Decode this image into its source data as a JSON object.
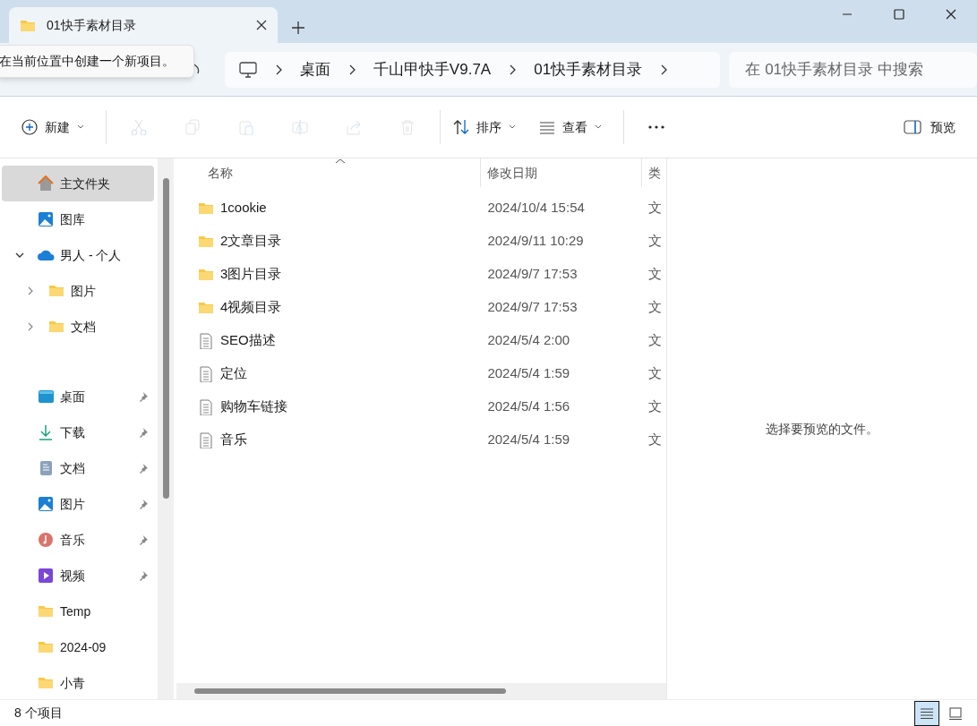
{
  "tab": {
    "title": "01快手素材目录",
    "selected": true
  },
  "tooltip": "在当前位置中创建一个新项目。",
  "breadcrumb": [
    "桌面",
    "千山甲快手V9.7A",
    "01快手素材目录"
  ],
  "search": {
    "placeholder": "在 01快手素材目录 中搜索"
  },
  "toolbar": [
    {
      "kind": "new",
      "label": "新建",
      "disabled": false
    },
    {
      "kind": "cut",
      "disabled": true
    },
    {
      "kind": "copy",
      "disabled": true
    },
    {
      "kind": "paste",
      "disabled": true
    },
    {
      "kind": "rename",
      "disabled": true
    },
    {
      "kind": "share",
      "disabled": true
    },
    {
      "kind": "delete",
      "disabled": true
    },
    {
      "kind": "sort",
      "label": "排序",
      "disabled": false
    },
    {
      "kind": "view",
      "label": "查看",
      "disabled": false
    },
    {
      "kind": "more",
      "disabled": false
    }
  ],
  "preview_button": "预览",
  "sidebar": [
    {
      "kind": "home",
      "label": "主文件夹",
      "selected": true
    },
    {
      "kind": "gallery",
      "label": "图库",
      "selected": false
    },
    {
      "kind": "cloud",
      "label": "男人 - 个人",
      "selected": false,
      "expanded": true,
      "children": [
        {
          "kind": "folder",
          "label": "图片",
          "selected": false,
          "expanded": false
        },
        {
          "kind": "folder",
          "label": "文档",
          "selected": false,
          "expanded": false
        }
      ]
    },
    {
      "kind": "divider"
    },
    {
      "kind": "desktop",
      "label": "桌面",
      "selected": false,
      "pinned": true
    },
    {
      "kind": "download",
      "label": "下载",
      "selected": false,
      "pinned": true
    },
    {
      "kind": "documents",
      "label": "文档",
      "selected": false,
      "pinned": true
    },
    {
      "kind": "pictures",
      "label": "图片",
      "selected": false,
      "pinned": true
    },
    {
      "kind": "music",
      "label": "音乐",
      "selected": false,
      "pinned": true
    },
    {
      "kind": "video",
      "label": "视频",
      "selected": false,
      "pinned": true
    },
    {
      "kind": "folder",
      "label": "Temp",
      "selected": false,
      "pinned": false
    },
    {
      "kind": "folder",
      "label": "2024-09",
      "selected": false,
      "pinned": false
    },
    {
      "kind": "folder",
      "label": "小青",
      "selected": false,
      "pinned": false
    }
  ],
  "columns": [
    "名称",
    "修改日期",
    "类"
  ],
  "rows": [
    {
      "kind": "folder",
      "name": "1cookie",
      "modified": "2024/10/4 15:54",
      "type": "文"
    },
    {
      "kind": "folder",
      "name": "2文章目录",
      "modified": "2024/9/11 10:29",
      "type": "文"
    },
    {
      "kind": "folder",
      "name": "3图片目录",
      "modified": "2024/9/7 17:53",
      "type": "文"
    },
    {
      "kind": "folder",
      "name": "4视频目录",
      "modified": "2024/9/7 17:53",
      "type": "文"
    },
    {
      "kind": "file",
      "name": "SEO描述",
      "modified": "2024/5/4 2:00",
      "type": "文"
    },
    {
      "kind": "file",
      "name": "定位",
      "modified": "2024/5/4 1:59",
      "type": "文"
    },
    {
      "kind": "file",
      "name": "购物车链接",
      "modified": "2024/5/4 1:56",
      "type": "文"
    },
    {
      "kind": "file",
      "name": "音乐",
      "modified": "2024/5/4 1:59",
      "type": "文"
    }
  ],
  "preview_message": "选择要预览的文件。",
  "status": "8 个项目",
  "view_modes": [
    {
      "kind": "details",
      "selected": true
    },
    {
      "kind": "tiles",
      "selected": false
    }
  ]
}
